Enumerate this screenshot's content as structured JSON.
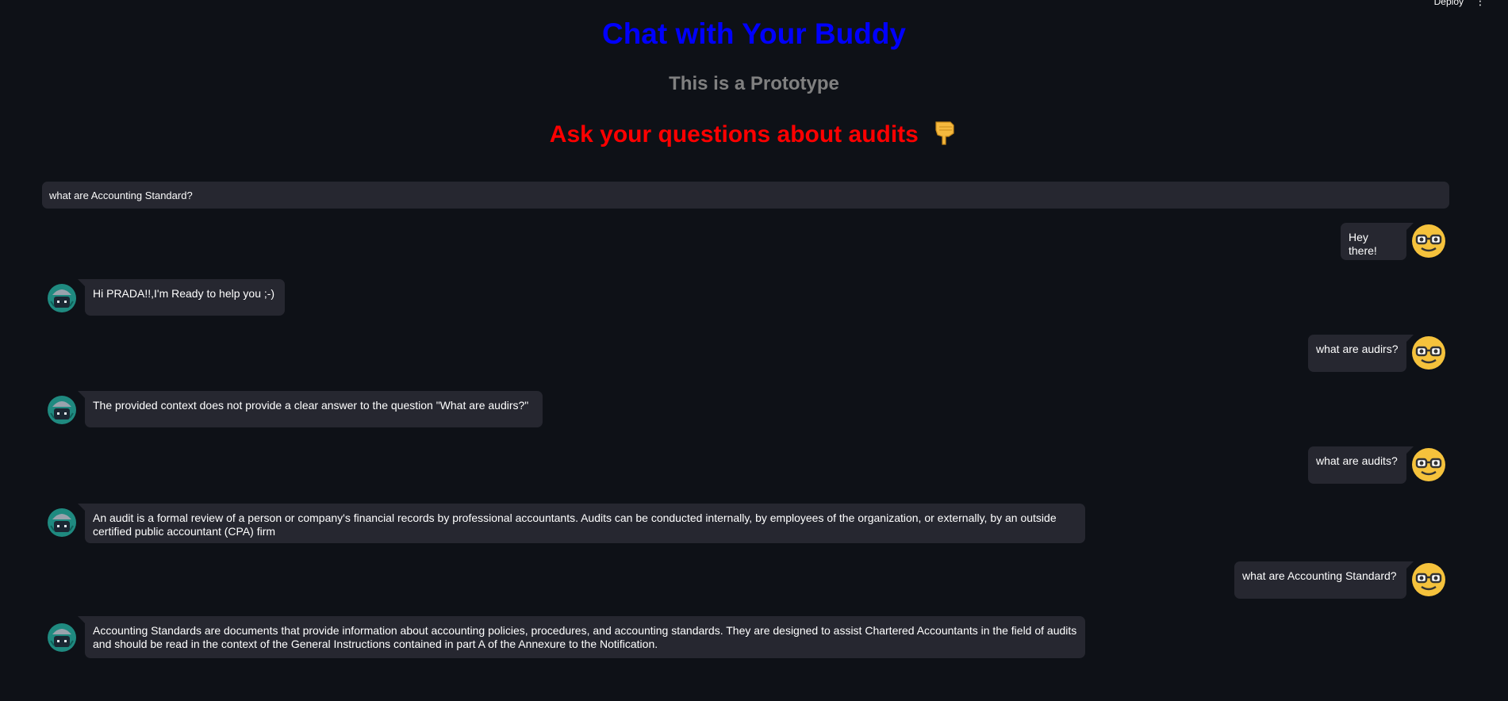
{
  "header": {
    "deploy_label": "Deploy",
    "menu_icon": "kebab-menu-icon"
  },
  "title": "Chat with Your Buddy",
  "subtitle": "This is a Prototype",
  "prompt": {
    "text": "Ask your questions about audits",
    "emoji": "👇"
  },
  "input": {
    "value": "what are Accounting Standard?"
  },
  "colors": {
    "title": "#0000ff",
    "subtitle": "#808080",
    "prompt": "#ff0000",
    "background": "#0e1117",
    "bubble": "#262730"
  },
  "messages": [
    {
      "role": "user",
      "text": "Hey there!"
    },
    {
      "role": "bot",
      "text": "Hi PRADA!!,I'm Ready to help you ;-)"
    },
    {
      "role": "user",
      "text": "what are audirs?"
    },
    {
      "role": "bot",
      "text": "The provided context does not provide a clear answer to the question \"What are audirs?\""
    },
    {
      "role": "user",
      "text": "what are audits?"
    },
    {
      "role": "bot",
      "text": "An audit is a formal review of a person or company's financial records by professional accountants. Audits can be conducted internally, by employees of the organization, or externally, by an outside certified public accountant (CPA) firm"
    },
    {
      "role": "user",
      "text": "what are Accounting Standard?"
    },
    {
      "role": "bot",
      "text": "Accounting Standards are documents that provide information about accounting policies, procedures, and accounting standards. They are designed to assist Chartered Accountants in the field of audits and should be read in the context of the General Instructions contained in part A of the Annexure to the Notification."
    }
  ]
}
